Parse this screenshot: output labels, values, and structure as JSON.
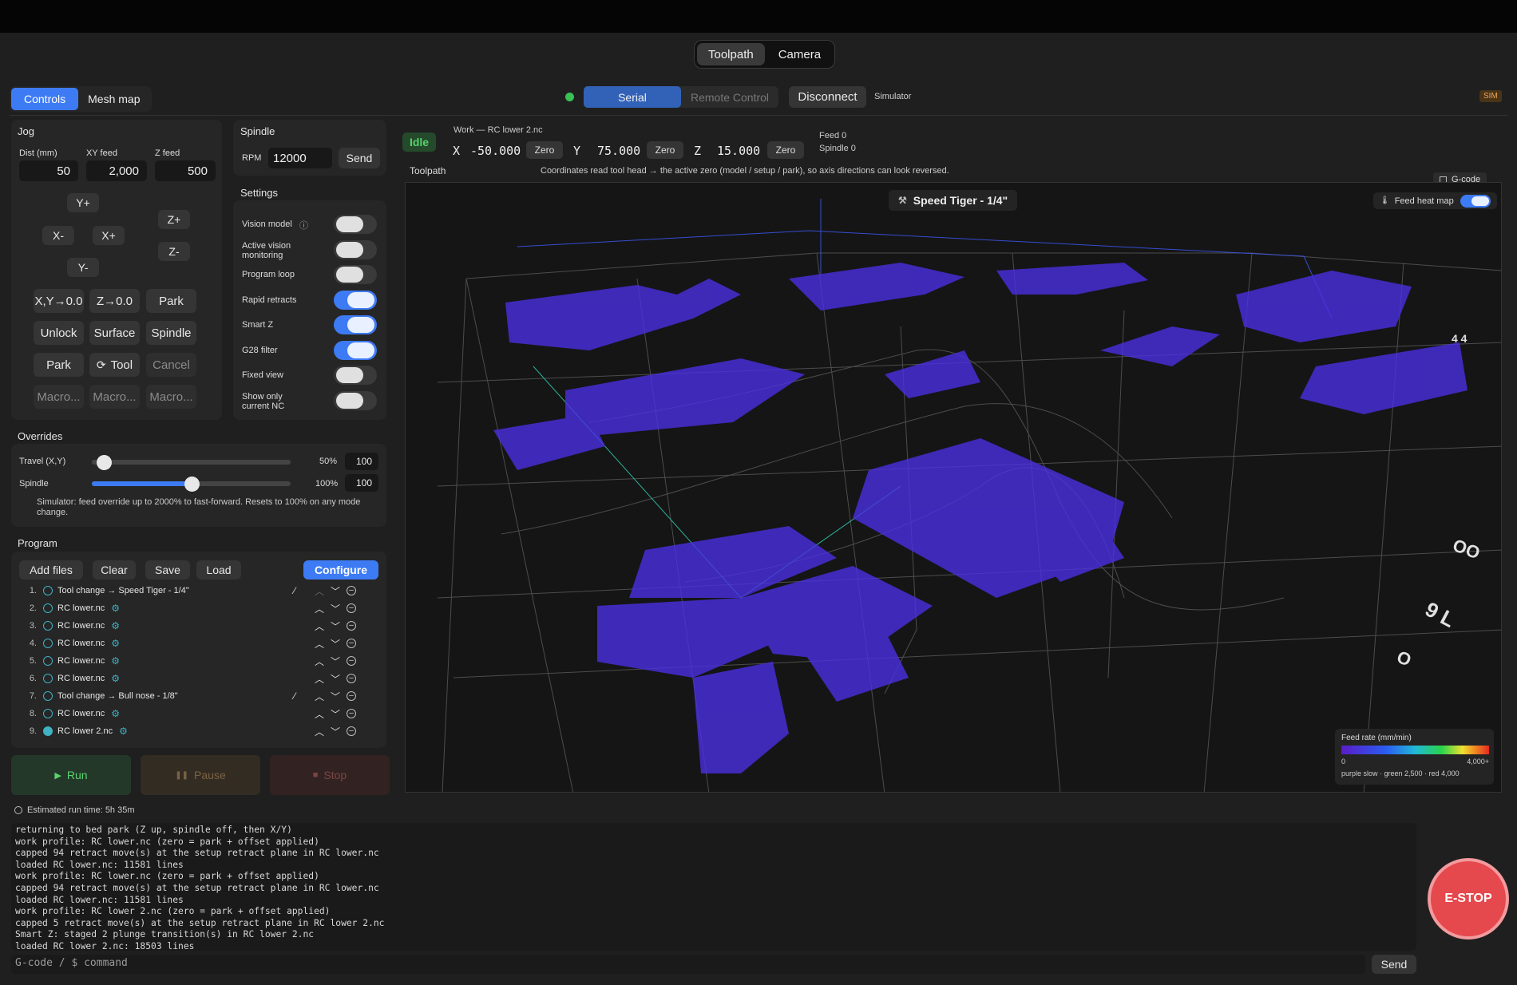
{
  "view_tabs": [
    "Toolpath",
    "Camera"
  ],
  "left_tabs": [
    "Controls",
    "Mesh map"
  ],
  "connection": {
    "tabs": [
      "Serial",
      "Remote Control"
    ],
    "disconnect": "Disconnect",
    "mode": "Simulator",
    "badge": "SIM"
  },
  "jog": {
    "title": "Jog",
    "dist_label": "Dist (mm)",
    "xy_label": "XY feed",
    "z_label": "Z feed",
    "dist": "50",
    "xy": "2,000",
    "z": "500",
    "yplus": "Y+",
    "yminus": "Y-",
    "xminus": "X-",
    "xplus": "X+",
    "zplus": "Z+",
    "zminus": "Z-",
    "grid": [
      [
        "X,Y→0.0",
        "Z→0.0",
        "Park"
      ],
      [
        "Unlock",
        "Surface",
        "Spindle"
      ],
      [
        "Park",
        "Tool",
        "Cancel"
      ],
      [
        "Macro...",
        "Macro...",
        "Macro..."
      ]
    ]
  },
  "spindle": {
    "title": "Spindle",
    "rpm_label": "RPM",
    "rpm": "12000",
    "send": "Send"
  },
  "settings": {
    "title": "Settings",
    "items": [
      {
        "label": "Vision model",
        "on": false
      },
      {
        "label": "Active vision monitoring",
        "on": false
      },
      {
        "label": "Program loop",
        "on": false
      },
      {
        "label": "Rapid retracts",
        "on": true
      },
      {
        "label": "Smart Z",
        "on": true
      },
      {
        "label": "G28 filter",
        "on": true
      },
      {
        "label": "Fixed view",
        "on": false
      },
      {
        "label": "Show only current NC",
        "on": false
      }
    ]
  },
  "overrides": {
    "title": "Overrides",
    "travel_label": "Travel (X,Y)",
    "travel_pct": "50%",
    "travel_val": "100",
    "travel_fill": 0.06,
    "spindle_label": "Spindle",
    "spindle_pct": "100%",
    "spindle_val": "100",
    "spindle_fill": 0.5,
    "note": "Simulator: feed override up to 2000% to fast-forward. Resets to 100% on any mode change."
  },
  "program": {
    "title": "Program",
    "add": "Add files",
    "clear": "Clear",
    "save": "Save",
    "load": "Load",
    "configure": "Configure",
    "items": [
      {
        "n": "1.",
        "name": "Tool change → Speed Tiger - 1/4\"",
        "tool": true
      },
      {
        "n": "2.",
        "name": "RC lower.nc"
      },
      {
        "n": "3.",
        "name": "RC lower.nc"
      },
      {
        "n": "4.",
        "name": "RC lower.nc"
      },
      {
        "n": "5.",
        "name": "RC lower.nc"
      },
      {
        "n": "6.",
        "name": "RC lower.nc"
      },
      {
        "n": "7.",
        "name": "Tool change → Bull nose - 1/8\"",
        "tool": true
      },
      {
        "n": "8.",
        "name": "RC lower.nc"
      },
      {
        "n": "9.",
        "name": "RC lower 2.nc",
        "current": true
      }
    ]
  },
  "run": {
    "run": "Run",
    "pause": "Pause",
    "stop": "Stop",
    "estimate": "Estimated run time: 5h 35m"
  },
  "status": {
    "state": "Idle",
    "work": "Work — RC lower 2.nc",
    "x": "-50.000",
    "y": "75.000",
    "z": "15.000",
    "zero": "Zero",
    "feed": "Feed 0",
    "spindle": "Spindle 0"
  },
  "toolpath": {
    "title": "Toolpath",
    "hint": "Coordinates read tool head → the active zero (model / setup / park), so axis directions can look reversed.",
    "gcode": "G-code",
    "tool": "Speed Tiger - 1/4\"",
    "heatmap": "Feed heat map",
    "legend": {
      "title": "Feed rate (mm/min)",
      "min": "0",
      "max": "4,000+",
      "desc": "purple slow · green 2,500 · red 4,000"
    }
  },
  "log": [
    "returning to bed park (Z up, spindle off, then X/Y)",
    "work profile: RC lower.nc (zero = park + offset applied)",
    "capped 94 retract move(s) at the setup retract plane in RC lower.nc",
    "loaded RC lower.nc: 11581 lines",
    "work profile: RC lower.nc (zero = park + offset applied)",
    "capped 94 retract move(s) at the setup retract plane in RC lower.nc",
    "loaded RC lower.nc: 11581 lines",
    "work profile: RC lower 2.nc (zero = park + offset applied)",
    "capped 5 retract move(s) at the setup retract plane in RC lower 2.nc",
    "Smart Z: staged 2 plunge transition(s) in RC lower 2.nc",
    "loaded RC lower 2.nc: 18503 lines"
  ],
  "command": {
    "placeholder": "G-code / $ command",
    "send": "Send"
  },
  "estop": "E-STOP"
}
